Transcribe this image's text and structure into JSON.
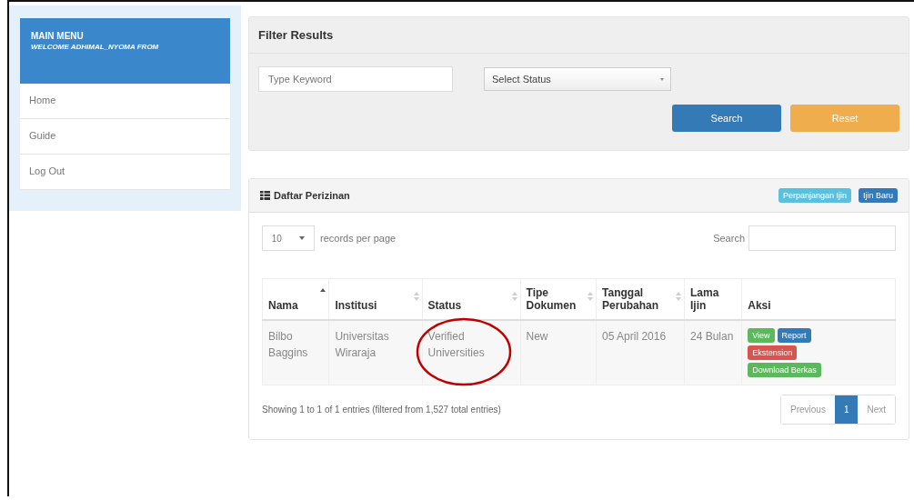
{
  "sidebar": {
    "title": "MAIN MENU",
    "welcome": "WELCOME ADHIMAL_NYOMA FROM",
    "items": [
      {
        "label": "Home"
      },
      {
        "label": "Guide"
      },
      {
        "label": "Log Out"
      }
    ]
  },
  "filter": {
    "title": "Filter Results",
    "keyword": {
      "placeholder": "Type Keyword"
    },
    "status": {
      "value": "Select Status"
    },
    "buttons": [
      {
        "label": "Search",
        "kind": "primary"
      },
      {
        "label": "Reset",
        "kind": "warning"
      }
    ]
  },
  "list": {
    "title": "Daftar Perizinan",
    "buttons": [
      {
        "label": "Perpanjangan Ijin",
        "kind": "info"
      },
      {
        "label": "Ijin Baru",
        "kind": "primary"
      }
    ],
    "page_size": "10",
    "page_size_label": "records per page",
    "search_label": "Search",
    "columns": [
      {
        "label": "Nama",
        "sortable": true,
        "sorted": true
      },
      {
        "label": "Institusi",
        "sortable": true,
        "sorted": false
      },
      {
        "label": "Status",
        "sortable": true,
        "sorted": false
      },
      {
        "label": "Tipe Dokumen",
        "sortable": true,
        "sorted": false
      },
      {
        "label": "Tanggal Perubahan",
        "sortable": true,
        "sorted": false
      },
      {
        "label": "Lama Ijin",
        "sortable": false
      },
      {
        "label": "Aksi",
        "sortable": false
      }
    ],
    "rows": [
      {
        "cells": [
          {
            "text": "Bilbo Baggins",
            "circled": false
          },
          {
            "text": "Universitas Wiraraja",
            "circled": false
          },
          {
            "text": "Verified Universities",
            "circled": true
          },
          {
            "text": "New",
            "circled": false
          },
          {
            "text": "05 April 2016",
            "circled": false
          },
          {
            "text": "24 Bulan",
            "circled": false
          }
        ],
        "actions": [
          {
            "label": "View",
            "kind": "success"
          },
          {
            "label": "Report",
            "kind": "primary"
          },
          {
            "label": "Ekstension",
            "kind": "danger"
          },
          {
            "label": "Download Berkas",
            "kind": "success"
          }
        ]
      }
    ],
    "info": "Showing 1 to 1 of 1 entries (filtered from 1,527 total entries)",
    "pagination": [
      {
        "label": "Previous",
        "selected": false
      },
      {
        "label": "1",
        "selected": true
      },
      {
        "label": "Next",
        "selected": false
      }
    ]
  }
}
